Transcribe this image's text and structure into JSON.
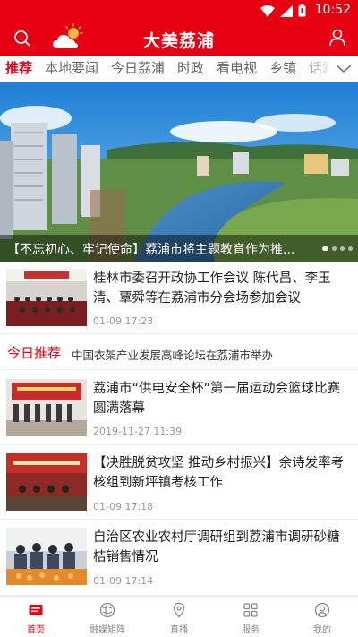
{
  "status_bar": {
    "time": "10:52",
    "icons": [
      "wifi-icon",
      "signal-icon",
      "battery-icon"
    ]
  },
  "header": {
    "title": "大美荔浦",
    "left_icon": "search-icon",
    "weather_icon": "weather-icon",
    "right_icon": "user-icon"
  },
  "tabs": {
    "items": [
      "推荐",
      "本地要闻",
      "今日荔浦",
      "时政",
      "看电视",
      "乡镇",
      "话题"
    ],
    "active_index": 0,
    "more_icon": "chevron-down-icon"
  },
  "banner": {
    "caption": "【不忘初心、牢记使命】荔浦市将主题教育作为推...",
    "slide_count": 4,
    "active_slide": 0
  },
  "news": [
    {
      "headline": "桂林市委召开政协工作会议 陈代昌、李玉清、覃舜等在荔浦市分会场参加会议",
      "date": "01-09 17:23"
    },
    {
      "headline": "荔浦市“供电安全杯”第一届运动会篮球比赛圆满落幕",
      "date": "2019-11-27 11:39"
    },
    {
      "headline": "【决胜脱贫攻坚 推动乡村振兴】余诗发率考核组到新坪镇考核工作",
      "date": "01-09 17:18"
    },
    {
      "headline": "自治区农业农村厅调研组到荔浦市调研砂糖桔销售情况",
      "date": "01-09 17:14"
    }
  ],
  "today": {
    "label": "今日推荐",
    "text": "中国衣架产业发展高峰论坛在荔浦市举办"
  },
  "bottom_nav": {
    "items": [
      {
        "label": "首页",
        "icon": "home-icon"
      },
      {
        "label": "融媒矩阵",
        "icon": "matrix-icon"
      },
      {
        "label": "直播",
        "icon": "live-icon"
      },
      {
        "label": "服务",
        "icon": "grid-icon"
      },
      {
        "label": "我的",
        "icon": "profile-icon"
      }
    ],
    "active_index": 0
  },
  "colors": {
    "brand": "#e60012",
    "muted": "#999999"
  }
}
